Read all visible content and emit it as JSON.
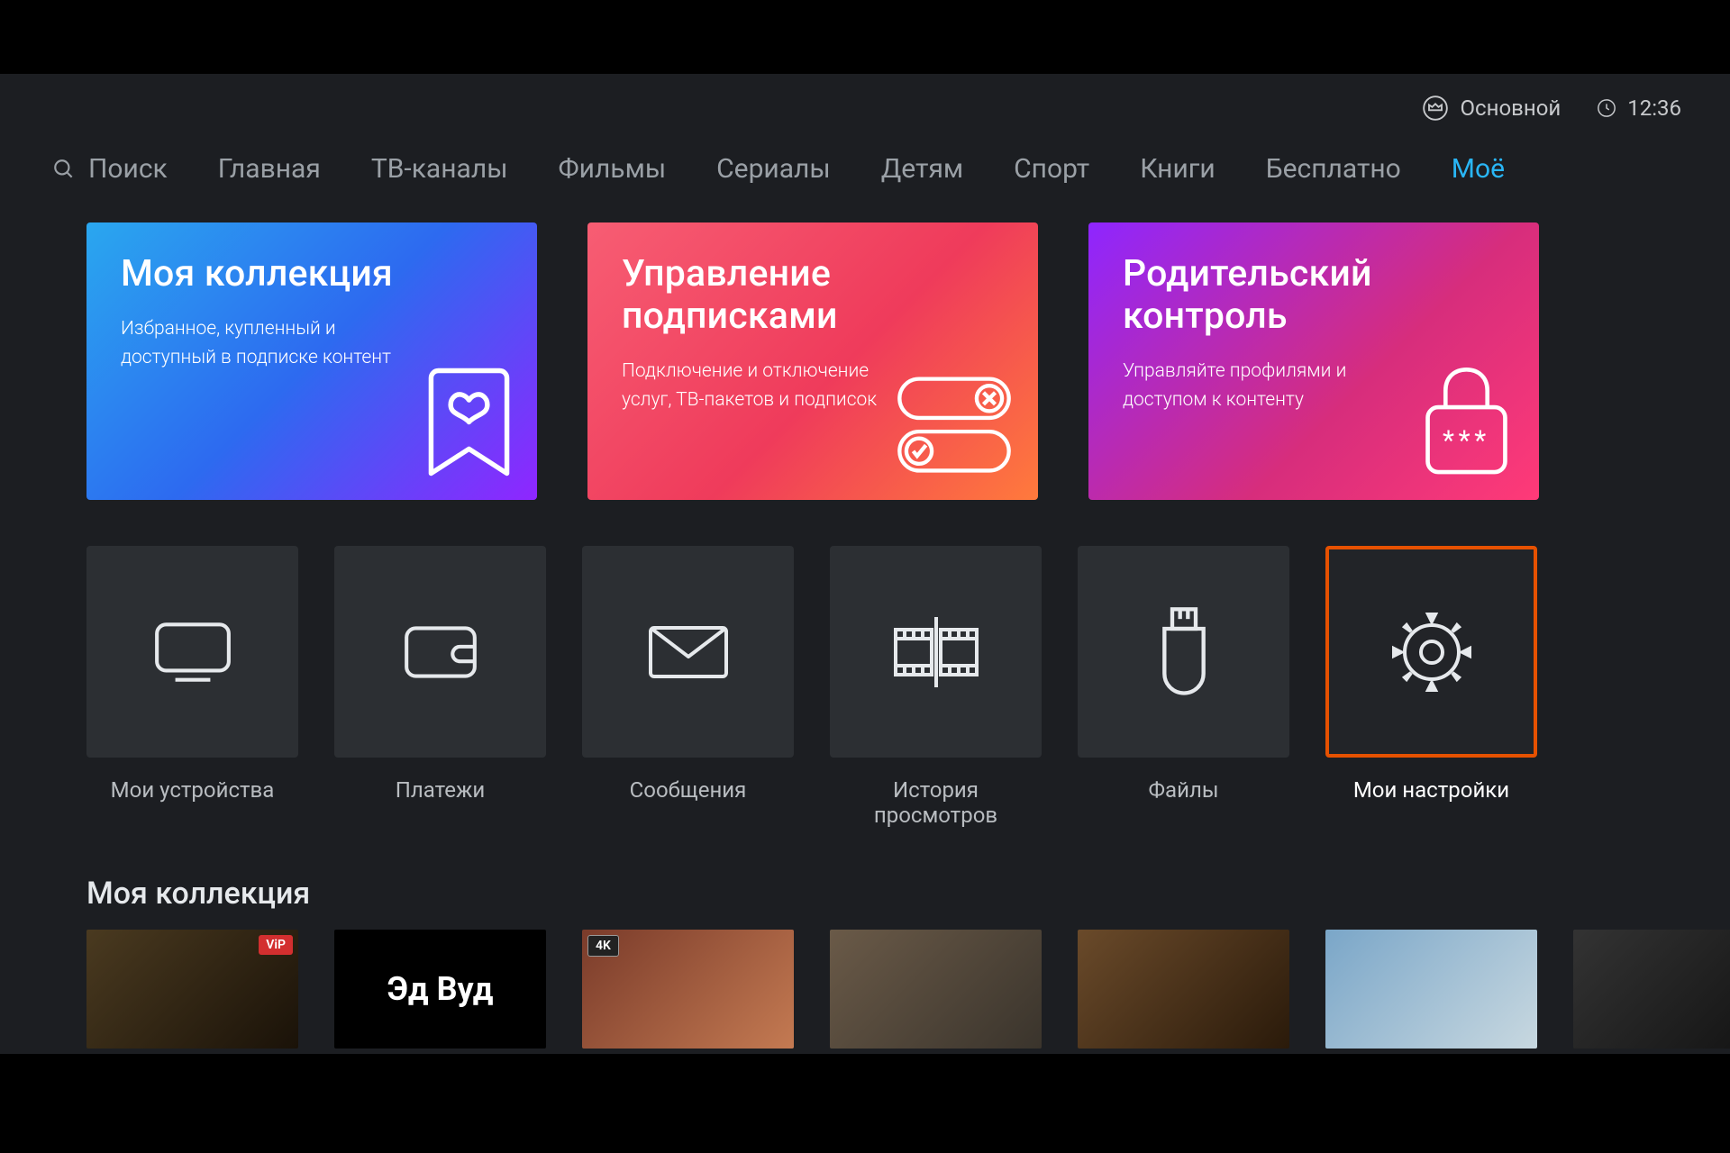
{
  "header": {
    "profile_label": "Основной",
    "time": "12:36"
  },
  "nav": {
    "search_label": "Поиск",
    "items": [
      {
        "label": "Главная",
        "active": false
      },
      {
        "label": "ТВ-каналы",
        "active": false
      },
      {
        "label": "Фильмы",
        "active": false
      },
      {
        "label": "Сериалы",
        "active": false
      },
      {
        "label": "Детям",
        "active": false
      },
      {
        "label": "Спорт",
        "active": false
      },
      {
        "label": "Книги",
        "active": false
      },
      {
        "label": "Бесплатно",
        "active": false
      },
      {
        "label": "Моё",
        "active": true
      }
    ]
  },
  "big_cards": [
    {
      "title": "Моя коллекция",
      "desc": "Избранное, купленный и доступный в подписке контент",
      "icon": "bookmark-heart"
    },
    {
      "title": "Управление подписками",
      "desc": "Подключение и отключение услуг, ТВ-пакетов и подписок",
      "icon": "toggles"
    },
    {
      "title": "Родительский контроль",
      "desc": "Управляйте профилями и доступом к контенту",
      "icon": "lock"
    }
  ],
  "tiles": [
    {
      "label": "Мои устройства",
      "icon": "tv",
      "selected": false
    },
    {
      "label": "Платежи",
      "icon": "wallet",
      "selected": false
    },
    {
      "label": "Сообщения",
      "icon": "mail",
      "selected": false
    },
    {
      "label": "История просмотров",
      "icon": "film",
      "selected": false
    },
    {
      "label": "Файлы",
      "icon": "usb",
      "selected": false
    },
    {
      "label": "Мои настройки",
      "icon": "gear",
      "selected": true
    }
  ],
  "section": {
    "title": "Моя коллекция"
  },
  "posters": [
    {
      "text": "",
      "badge": "ViP",
      "badge_kind": "vip",
      "bg": "linear-gradient(135deg,#4a3a20,#1a1208)"
    },
    {
      "text": "Эд Вуд",
      "badge": "",
      "badge_kind": "",
      "bg": "#000"
    },
    {
      "text": "",
      "badge": "4K",
      "badge_kind": "4k",
      "bg": "linear-gradient(135deg,#7a3b2a,#c47a52)"
    },
    {
      "text": "",
      "badge": "",
      "badge_kind": "",
      "bg": "linear-gradient(135deg,#6a5a48,#3a342c)"
    },
    {
      "text": "",
      "badge": "",
      "badge_kind": "",
      "bg": "linear-gradient(135deg,#6a4a2a,#2a1a0a)"
    },
    {
      "text": "",
      "badge": "",
      "badge_kind": "",
      "bg": "linear-gradient(135deg,#7aa6c8,#c8d8e0)"
    },
    {
      "text": "",
      "badge": "",
      "badge_kind": "",
      "bg": "linear-gradient(135deg,#333,#111)"
    }
  ]
}
